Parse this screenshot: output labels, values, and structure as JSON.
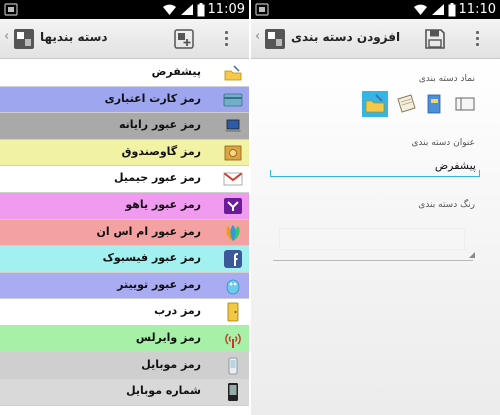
{
  "status_bar": {
    "left_time": "11:09",
    "right_time": "11:10"
  },
  "left_screen": {
    "title": "دسته بندیها",
    "chevron": "‹",
    "categories": [
      {
        "label": "پیشفرض",
        "color": "#ffffff",
        "icon": "folder-icon"
      },
      {
        "label": "رمز کارت اعتباری",
        "color": "#9ea6f0",
        "icon": "credit-card-icon"
      },
      {
        "label": "رمز عبور رایانه",
        "color": "#a9a9a9",
        "icon": "laptop-icon"
      },
      {
        "label": "رمز گاوصندوق",
        "color": "#f2f2a4",
        "icon": "safe-icon"
      },
      {
        "label": "رمز عبور جیمیل",
        "color": "#ffffff",
        "icon": "gmail-icon"
      },
      {
        "label": "رمز عبور یاهو",
        "color": "#f09af0",
        "icon": "yahoo-icon"
      },
      {
        "label": "رمز عبور ام اس ان",
        "color": "#f3a1a1",
        "icon": "msn-icon"
      },
      {
        "label": "رمز عبور فیسبوک",
        "color": "#a2f0f0",
        "icon": "facebook-icon"
      },
      {
        "label": "رمز عبور توییتر",
        "color": "#a9acf2",
        "icon": "twitter-icon"
      },
      {
        "label": "رمز درب",
        "color": "#ffffff",
        "icon": "door-icon"
      },
      {
        "label": "رمز وایرلس",
        "color": "#a7f0a7",
        "icon": "wireless-icon"
      },
      {
        "label": "رمز موبایل",
        "color": "#cfcfcf",
        "icon": "mobile-icon"
      },
      {
        "label": "شماره موبایل",
        "color": "#d9d9d9",
        "icon": "phone-icon"
      }
    ]
  },
  "right_screen": {
    "title": "افزودن دسته بندی",
    "chevron": "‹",
    "icon_label": "نماد دسته بندی",
    "icon_choices": [
      "folder-icon",
      "notepad-icon",
      "book-icon",
      "card-icon"
    ],
    "selected_icon": "folder-icon",
    "name_label": "عنوان دسته بندی",
    "name_value": "پیشفرض",
    "color_label": "رنگ دسته بندی"
  },
  "colors": {
    "accent": "#33b5e5",
    "status_bar": "#000000",
    "action_bar": "#ececec"
  }
}
